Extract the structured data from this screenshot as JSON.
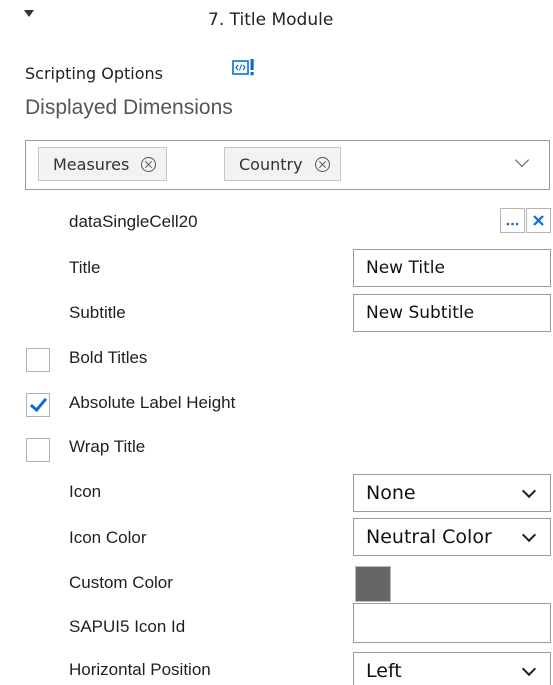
{
  "section": {
    "title": "7. Title Module"
  },
  "scripting": {
    "label": "Scripting Options",
    "icon": "script-code-icon"
  },
  "dimensions": {
    "label": "Displayed Dimensions",
    "tokens": [
      {
        "label": "Measures"
      },
      {
        "label": "Country"
      }
    ]
  },
  "data_source": {
    "name": "dataSingleCell20"
  },
  "fields": {
    "title": {
      "label": "Title",
      "value": "New Title"
    },
    "subtitle": {
      "label": "Subtitle",
      "value": "New Subtitle"
    },
    "bold_titles": {
      "label": "Bold Titles",
      "checked": false
    },
    "absolute_label_height": {
      "label": "Absolute Label Height",
      "checked": true
    },
    "wrap_title": {
      "label": "Wrap Title",
      "checked": false
    },
    "icon": {
      "label": "Icon",
      "value": "None"
    },
    "icon_color": {
      "label": "Icon Color",
      "value": "Neutral Color"
    },
    "custom_color": {
      "label": "Custom Color",
      "color": "#666666"
    },
    "sapui5_icon_id": {
      "label": "SAPUI5 Icon Id",
      "value": ""
    },
    "horizontal_position": {
      "label": "Horizontal Position",
      "value": "Left"
    }
  },
  "colors": {
    "accent": "#0a6ed1",
    "text": "#1f1f1f",
    "muted": "#555555",
    "border": "#9a9a9a"
  }
}
